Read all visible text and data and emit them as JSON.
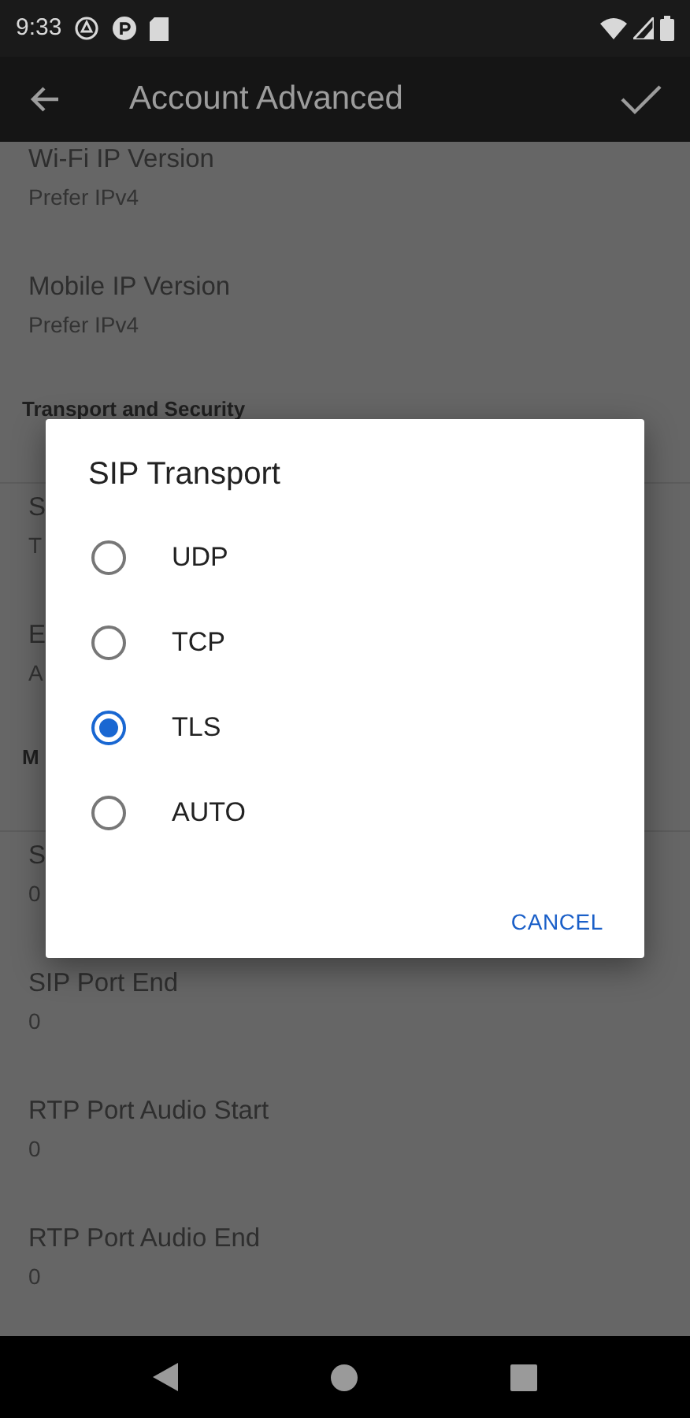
{
  "status_bar": {
    "time": "9:33"
  },
  "app_bar": {
    "title": "Account Advanced"
  },
  "preferences": [
    {
      "kind": "pref",
      "title": "Wi-Fi IP Version",
      "summary": "Prefer IPv4"
    },
    {
      "kind": "pref",
      "title": "Mobile IP Version",
      "summary": "Prefer IPv4"
    },
    {
      "kind": "header",
      "title": "Transport and Security"
    },
    {
      "kind": "pref",
      "title": "S",
      "summary": "T"
    },
    {
      "kind": "pref",
      "title": "E",
      "summary": "A"
    },
    {
      "kind": "header",
      "title": "M"
    },
    {
      "kind": "pref",
      "title": "S",
      "summary": "0"
    },
    {
      "kind": "pref",
      "title": "SIP Port End",
      "summary": "0"
    },
    {
      "kind": "pref",
      "title": "RTP Port Audio Start",
      "summary": "0"
    },
    {
      "kind": "pref",
      "title": "RTP Port Audio End",
      "summary": "0"
    }
  ],
  "dialog": {
    "title": "SIP Transport",
    "options": [
      {
        "label": "UDP",
        "selected": false
      },
      {
        "label": "TCP",
        "selected": false
      },
      {
        "label": "TLS",
        "selected": true
      },
      {
        "label": "AUTO",
        "selected": false
      }
    ],
    "buttons": [
      "CANCEL"
    ]
  }
}
